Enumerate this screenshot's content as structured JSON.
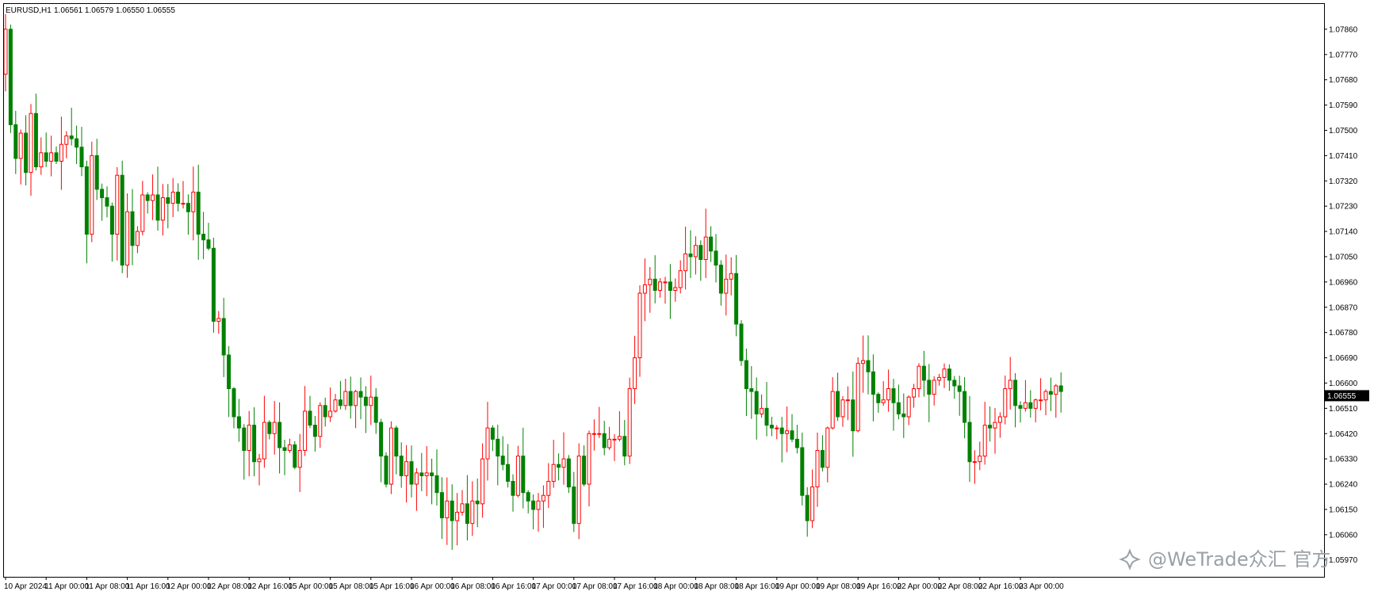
{
  "header": {
    "symbol": "EURUSD,H1",
    "ohlc": "1.06561 1.06579 1.06550 1.06555"
  },
  "watermark": {
    "text": "@WeTrade众汇 官方",
    "icon": "sparkle-logo-icon"
  },
  "colors": {
    "bull": "#ff0000",
    "bear": "#008000",
    "price_tag_bg": "#000000",
    "price_tag_fg": "#ffffff",
    "background": "#ffffff",
    "axis": "#000000"
  },
  "chart_data": {
    "type": "candlestick",
    "ylim": [
      1.0591,
      1.0795
    ],
    "y_ticks": [
      "1.07860",
      "1.07770",
      "1.07680",
      "1.07590",
      "1.07500",
      "1.07410",
      "1.07320",
      "1.07230",
      "1.07140",
      "1.07050",
      "1.06960",
      "1.06870",
      "1.06780",
      "1.06690",
      "1.06600",
      "1.06510",
      "1.06420",
      "1.06330",
      "1.06240",
      "1.06150",
      "1.06060",
      "1.05970"
    ],
    "x_ticks": [
      "10 Apr 2024",
      "11 Apr 00:00",
      "11 Apr 08:00",
      "11 Apr 16:00",
      "12 Apr 00:00",
      "12 Apr 08:00",
      "12 Apr 16:00",
      "15 Apr 00:00",
      "15 Apr 08:00",
      "15 Apr 16:00",
      "16 Apr 00:00",
      "16 Apr 08:00",
      "16 Apr 16:00",
      "17 Apr 00:00",
      "17 Apr 08:00",
      "17 Apr 16:00",
      "18 Apr 00:00",
      "18 Apr 08:00",
      "18 Apr 16:00",
      "19 Apr 00:00",
      "19 Apr 08:00",
      "19 Apr 16:00",
      "22 Apr 00:00",
      "22 Apr 08:00",
      "22 Apr 16:00",
      "23 Apr 00:00"
    ],
    "last_price": "1.06555",
    "close": [
      1.0786,
      1.0752,
      1.074,
      1.0749,
      1.0735,
      1.0756,
      1.0737,
      1.0742,
      1.0739,
      1.0742,
      1.0739,
      1.0745,
      1.0748,
      1.0747,
      1.0744,
      1.0737,
      1.0713,
      1.0741,
      1.0729,
      1.0726,
      1.0723,
      1.0713,
      1.0734,
      1.0702,
      1.0721,
      1.0709,
      1.0714,
      1.0727,
      1.0725,
      1.0727,
      1.0718,
      1.0726,
      1.0724,
      1.0728,
      1.0724,
      1.0724,
      1.0721,
      1.0728,
      1.0713,
      1.0711,
      1.0708,
      1.0682,
      1.0683,
      1.067,
      1.0658,
      1.0648,
      1.0644,
      1.0636,
      1.0645,
      1.0632,
      1.0633,
      1.0646,
      1.0642,
      1.0646,
      1.0637,
      1.0636,
      1.0638,
      1.063,
      1.0636,
      1.065,
      1.0645,
      1.0641,
      1.0652,
      1.0648,
      1.065,
      1.0654,
      1.0652,
      1.0657,
      1.0652,
      1.0657,
      1.0655,
      1.0652,
      1.0655,
      1.0646,
      1.0634,
      1.0624,
      1.0644,
      1.0634,
      1.0627,
      1.0632,
      1.0624,
      1.0628,
      1.0627,
      1.0628,
      1.0627,
      1.0621,
      1.0612,
      1.0618,
      1.0611,
      1.0614,
      1.0617,
      1.061,
      1.0618,
      1.0617,
      1.0633,
      1.0644,
      1.064,
      1.0634,
      1.0631,
      1.0625,
      1.062,
      1.0634,
      1.0621,
      1.0618,
      1.0615,
      1.0618,
      1.062,
      1.0625,
      1.0631,
      1.063,
      1.0633,
      1.0623,
      1.061,
      1.0634,
      1.0624,
      1.0642,
      1.0642,
      1.0642,
      1.0637,
      1.064,
      1.064,
      1.0641,
      1.0634,
      1.0658,
      1.0669,
      1.0692,
      1.0695,
      1.0697,
      1.0693,
      1.0696,
      1.0696,
      1.0693,
      1.0694,
      1.07,
      1.0706,
      1.0705,
      1.0709,
      1.0704,
      1.0712,
      1.0707,
      1.0702,
      1.0692,
      1.0697,
      1.0699,
      1.0681,
      1.0668,
      1.0658,
      1.0657,
      1.0649,
      1.0651,
      1.0645,
      1.0644,
      1.0644,
      1.0642,
      1.0643,
      1.064,
      1.0637,
      1.062,
      1.0611,
      1.0623,
      1.0636,
      1.063,
      1.0644,
      1.0657,
      1.0648,
      1.0654,
      1.0654,
      1.0643,
      1.0667,
      1.0668,
      1.0664,
      1.0656,
      1.0653,
      1.0654,
      1.0658,
      1.0653,
      1.0649,
      1.0648,
      1.0655,
      1.0658,
      1.0666,
      1.0661,
      1.0656,
      1.0661,
      1.0662,
      1.0665,
      1.0661,
      1.0659,
      1.0657,
      1.0646,
      1.0632,
      1.0632,
      1.0634,
      1.0645,
      1.0644,
      1.0646,
      1.0648,
      1.0658,
      1.0661,
      1.0652,
      1.0651,
      1.0653,
      1.0651,
      1.0654,
      1.0654,
      1.0657,
      1.0656,
      1.0659,
      1.0657
    ]
  }
}
